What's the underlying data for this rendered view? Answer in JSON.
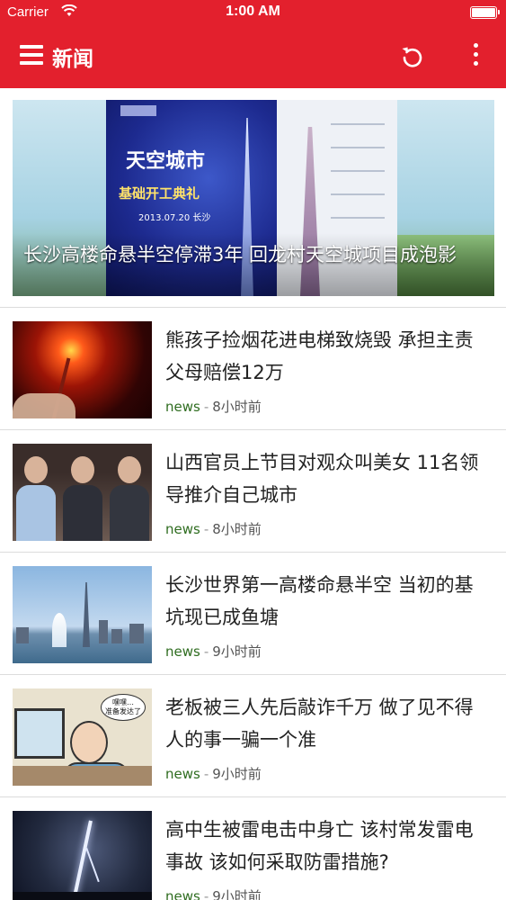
{
  "status_bar": {
    "carrier": "Carrier",
    "time": "1:00 AM"
  },
  "nav": {
    "title": "新闻",
    "icons": [
      "menu-icon",
      "refresh-icon",
      "more-icon"
    ]
  },
  "hero": {
    "caption": "长沙高楼命悬半空停滞3年 回龙村天空城项目成泡影",
    "board_title": "天空城市",
    "board_subtitle": "基础开工典礼",
    "board_date": "2013.07.20 长沙"
  },
  "articles": [
    {
      "headline": "熊孩子捡烟花进电梯致烧毁 承担主责父母赔偿12万",
      "source": "news",
      "separator": "-",
      "time": "8小时前"
    },
    {
      "headline": "山西官员上节目对观众叫美女 11名领导推介自己城市",
      "source": "news",
      "separator": "-",
      "time": "8小时前"
    },
    {
      "headline": "长沙世界第一高楼命悬半空 当初的基坑现已成鱼塘",
      "source": "news",
      "separator": "-",
      "time": "9小时前"
    },
    {
      "headline": "老板被三人先后敲诈千万 做了见不得人的事一骗一个准",
      "source": "news",
      "separator": "-",
      "time": "9小时前"
    },
    {
      "headline": "高中生被雷电击中身亡 该村常发雷电事故 该如何采取防雷措施?",
      "source": "news",
      "separator": "-",
      "time": "9小时前"
    }
  ],
  "cartoon_bubble": "嘿嘿…\n准备发达了",
  "colors": {
    "brand_red": "#e3202d",
    "source_green": "#2f6d20",
    "text": "#222222",
    "meta": "#555555"
  }
}
